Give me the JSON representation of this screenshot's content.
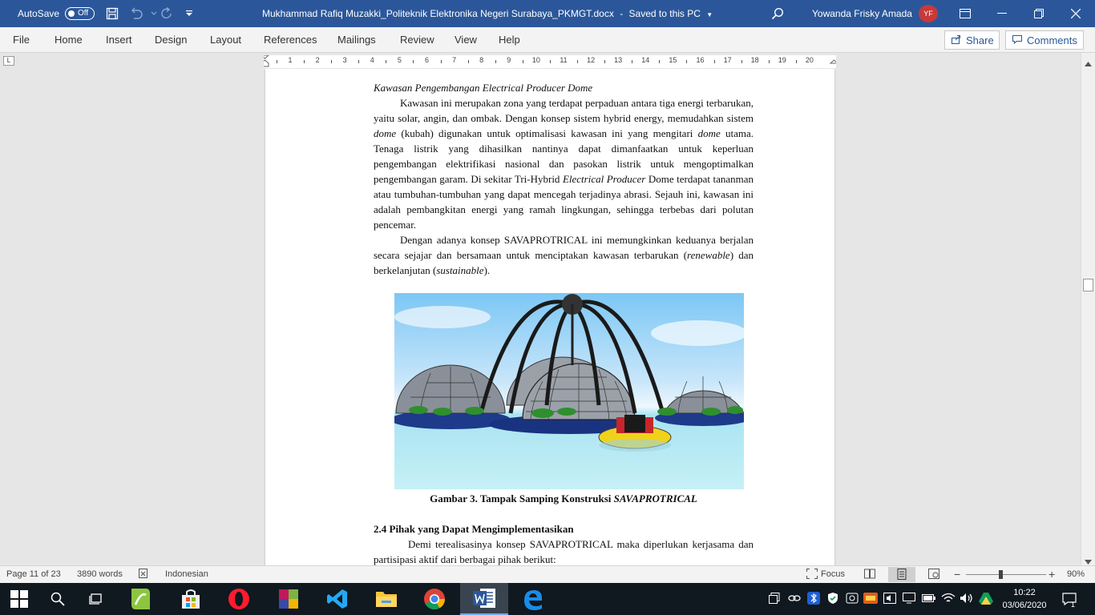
{
  "titlebar": {
    "autosave_label": "AutoSave",
    "autosave_state": "Off",
    "document_title": "Mukhammad Rafiq Muzakki_Politeknik Elektronika Negeri Surabaya_PKMGT.docx",
    "saved_status": "Saved to this PC",
    "title_separator": "-",
    "user_name": "Yowanda Frisky Amada",
    "user_initials": "YF"
  },
  "ribbon": {
    "tabs": [
      "File",
      "Home",
      "Insert",
      "Design",
      "Layout",
      "References",
      "Mailings",
      "Review",
      "View",
      "Help"
    ],
    "share_label": "Share",
    "comments_label": "Comments"
  },
  "ruler": {
    "corner_marker": "L",
    "numbers": [
      "1",
      "2",
      "3",
      "4",
      "5",
      "6",
      "7",
      "8",
      "9",
      "10",
      "11",
      "12",
      "13",
      "14",
      "15",
      "16",
      "17",
      "18",
      "19",
      "20"
    ]
  },
  "document": {
    "p1_heading": "Kawasan Pengembangan Electrical Producer Dome",
    "p2_part1": "Kawasan ini merupakan zona yang terdapat perpaduan antara tiga energi terbarukan, yaitu solar, angin, dan ombak. Dengan konsep sistem hybrid energy, memudahkan sistem ",
    "p2_dome1": "dome",
    "p2_part2": " (kubah) digunakan untuk optimalisasi kawasan ini yang mengitari ",
    "p2_dome2": "dome",
    "p2_part3": " utama. Tenaga listrik yang dihasilkan nantinya dapat dimanfaatkan untuk keperluan pengembangan elektrifikasi nasional dan pasokan listrik untuk mengoptimalkan pengembangan garam. Di sekitar Tri-Hybrid ",
    "p2_ep": "Electrical Producer",
    "p2_part4": " Dome terdapat tananman atau tumbuhan-tumbuhan yang dapat mencegah terjadinya abrasi. Sejauh ini, kawasan ini adalah pembangkitan energi yang ramah lingkungan, sehingga terbebas dari polutan pencemar.",
    "p3_part1": "Dengan adanya konsep SAVAPROTRICAL ini memungkinkan keduanya berjalan secara sejajar dan bersamaan untuk menciptakan kawasan terbarukan (",
    "p3_renewable": "renewable",
    "p3_part2": ") dan berkelanjutan (",
    "p3_sustainable": "sustainable",
    "p3_part3": ").",
    "caption_text": "Gambar 3. Tampak Samping Konstruksi ",
    "caption_italic": "SAVAPROTRICAL",
    "section_heading": "2.4 Pihak yang Dapat Mengimplementasikan",
    "p4_text": "Demi terealisasinya konsep SAVAPROTRICAL maka diperlukan kerjasama dan partisipasi aktif dari berbagai pihak berikut:"
  },
  "statusbar": {
    "page_info": "Page 11 of 23",
    "word_count": "3890 words",
    "language": "Indonesian",
    "focus_label": "Focus",
    "zoom_minus": "−",
    "zoom_plus": "+",
    "zoom_level": "90%",
    "zoom_fraction": 0.43
  },
  "taskbar": {
    "apps": [
      "windows-start",
      "search",
      "task-view",
      "green-app",
      "store",
      "opera",
      "winrar",
      "vscode",
      "file-explorer",
      "chrome",
      "word",
      "edge"
    ],
    "time": "10:22",
    "date": "03/06/2020",
    "notification_count": "1"
  },
  "colors": {
    "title_bar": "#2b579a",
    "ribbon_bg": "#f3f3f3",
    "canvas_bg": "#e6e6e6",
    "avatar": "#c73a3a",
    "taskbar": "#101820"
  }
}
